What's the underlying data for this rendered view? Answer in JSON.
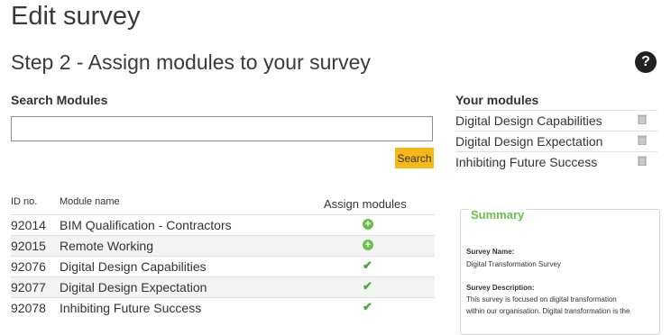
{
  "page": {
    "title": "Edit survey",
    "step_title": "Step 2 - Assign modules to your survey",
    "help_label": "?"
  },
  "search": {
    "heading": "Search Modules",
    "value": "",
    "placeholder": "",
    "button_label": "Search"
  },
  "modules_table": {
    "columns": {
      "id": "ID no.",
      "name": "Module name",
      "assign": "Assign modules"
    },
    "rows": [
      {
        "id": "92014",
        "name": "BIM Qualification - Contractors",
        "action": "add"
      },
      {
        "id": "92015",
        "name": "Remote Working",
        "action": "add"
      },
      {
        "id": "92076",
        "name": "Digital Design Capabilities",
        "action": "assigned"
      },
      {
        "id": "92077",
        "name": "Digital Design Expectation",
        "action": "assigned"
      },
      {
        "id": "92078",
        "name": "Inhibiting Future Success",
        "action": "assigned"
      }
    ]
  },
  "your_modules": {
    "heading": "Your modules",
    "items": [
      {
        "label": "Digital Design Capabilities",
        "icon": "remove-icon"
      },
      {
        "label": "Digital Design Expectation",
        "icon": "remove-icon"
      },
      {
        "label": "Inhibiting Future Success",
        "icon": "remove-icon"
      }
    ]
  },
  "summary": {
    "title": "Summary",
    "survey_name_label": "Survey Name:",
    "survey_name": "Digital Transformation Survey",
    "survey_description_label": "Survey Description:",
    "survey_description_line1": "This survey is focused on digital transformation",
    "survey_description_line2": "within our organisation. Digital transformation is the"
  },
  "colors": {
    "accent_button": "#f5b817",
    "success_green": "#6cbf4c",
    "check_green": "#48a83a"
  }
}
